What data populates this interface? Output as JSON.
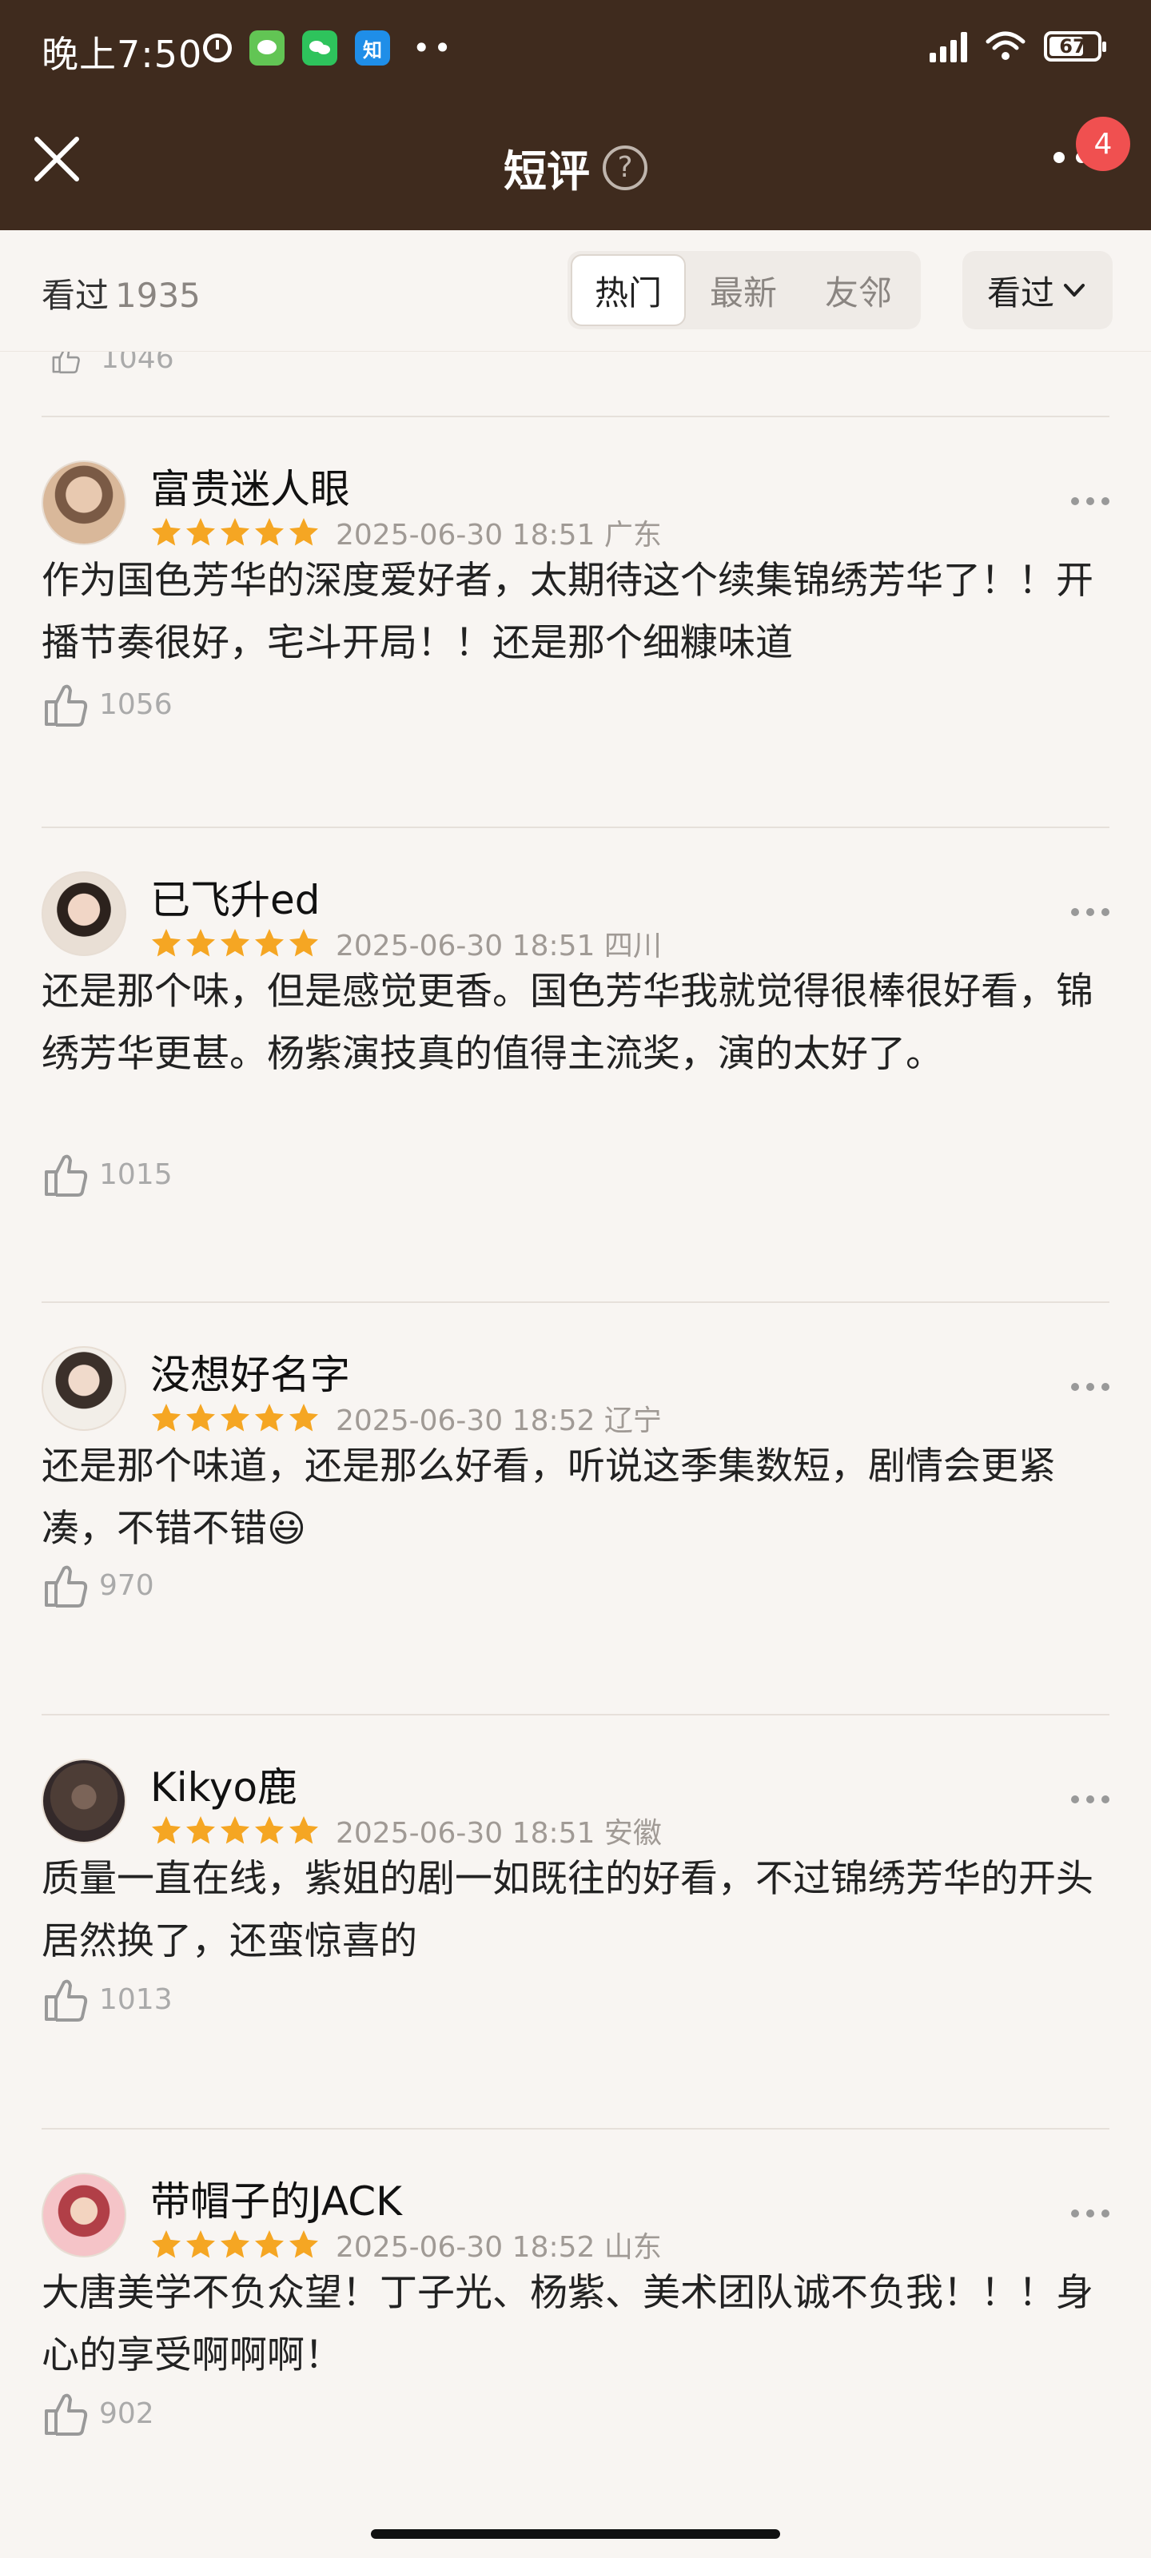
{
  "status_bar": {
    "time": "晚上7:50",
    "app_icon_zhi": "知",
    "battery": "67"
  },
  "header": {
    "title": "短评",
    "help_glyph": "?",
    "notification_count": "4"
  },
  "filter": {
    "seen_label": "看过",
    "seen_count": "1935",
    "tabs": [
      {
        "label": "热门",
        "active": true
      },
      {
        "label": "最新",
        "active": false
      },
      {
        "label": "友邻",
        "active": false
      }
    ],
    "status_select": "看过"
  },
  "partial_like_count": "1046",
  "comments": [
    {
      "user": "富贵迷人眼",
      "stars": 5,
      "date": "2025-06-30 18:51 广东",
      "text": "作为国色芳华的深度爱好者，太期待这个续集锦绣芳华了！！开播节奏很好，宅斗开局！！还是那个细糠味道",
      "likes": "1056"
    },
    {
      "user": "已飞升ed",
      "stars": 5,
      "date": "2025-06-30 18:51 四川",
      "text": "还是那个味，但是感觉更香。国色芳华我就觉得很棒很好看，锦绣芳华更甚。杨紫演技真的值得主流奖，演的太好了。",
      "likes": "1015"
    },
    {
      "user": "没想好名字",
      "stars": 5,
      "date": "2025-06-30 18:52 辽宁",
      "text": "还是那个味道，还是那么好看，听说这季集数短，剧情会更紧凑，不错不错😃",
      "likes": "970"
    },
    {
      "user": "Kikyo鹿",
      "stars": 5,
      "date": "2025-06-30 18:51 安徽",
      "text": "质量一直在线，紫姐的剧一如既往的好看，不过锦绣芳华的开头居然换了，还蛮惊喜的",
      "likes": "1013"
    },
    {
      "user": "带帽子的JACK",
      "stars": 5,
      "date": "2025-06-30 18:52 山东",
      "text": "大唐美学不负众望！丁子光、杨紫、美术团队诚不负我！！！身心的享受啊啊啊！",
      "likes": "902"
    }
  ],
  "colors": {
    "header_bg": "#3f2b1e",
    "star": "#f5a623",
    "badge": "#f05050"
  }
}
